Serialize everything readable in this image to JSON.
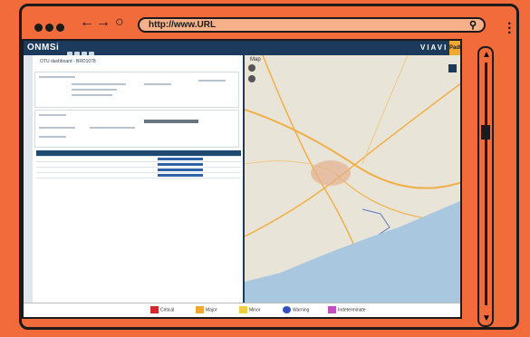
{
  "browser": {
    "url": "http://www.URL",
    "back_icon": "back-arrow-icon",
    "forward_icon": "forward-arrow-icon",
    "reload_icon": "reload-icon",
    "search_icon": "search-icon",
    "menu_icon": "kebab-menu-icon"
  },
  "app": {
    "logo": "ONMSi",
    "brand_viavi": "VIAVI",
    "brand_padtec": "Padtec",
    "dashboard_title": "OTU dashboard - BRD1078",
    "map_title": "Map"
  },
  "legend": [
    {
      "label": "Critical",
      "color": "#d02a2a",
      "icon": "critical-alarm-icon"
    },
    {
      "label": "Major",
      "color": "#f0a830",
      "icon": "major-alarm-icon"
    },
    {
      "label": "Minor",
      "color": "#f0d040",
      "icon": "minor-alarm-icon"
    },
    {
      "label": "Warning",
      "color": "#3050c0",
      "icon": "warning-alarm-icon"
    },
    {
      "label": "Indeterminate",
      "color": "#c050c0",
      "icon": "indeterminate-alarm-icon"
    }
  ],
  "colors": {
    "frame": "#f26b3a",
    "header": "#1b3a5c",
    "accent": "#3a8fd6"
  }
}
